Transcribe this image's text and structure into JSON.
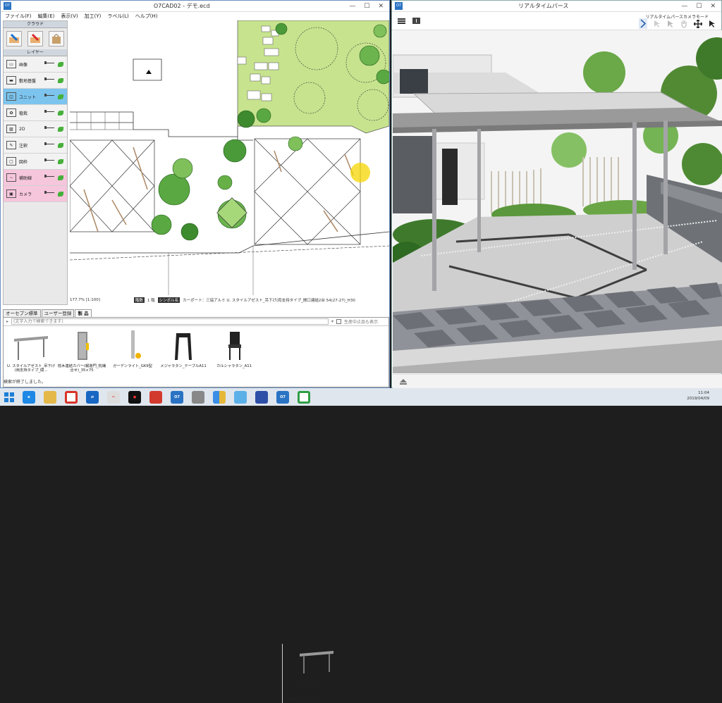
{
  "cad": {
    "title": "O7CAD02 - デモ.ecd",
    "menu": [
      "ファイル(F)",
      "編集(E)",
      "表示(V)",
      "加工(Y)",
      "ラベル(L)",
      "ヘルプ(H)"
    ],
    "cloud_header": "クラウド",
    "layers_header": "レイヤー",
    "layers": [
      {
        "name": "画像",
        "state": "normal",
        "icon": "image-icon"
      },
      {
        "name": "敷地基盤",
        "state": "normal",
        "icon": "site-base-icon"
      },
      {
        "name": "ユニット",
        "state": "selected",
        "icon": "unit-book-icon"
      },
      {
        "name": "植栽",
        "state": "normal",
        "icon": "plant-icon"
      },
      {
        "name": "2D",
        "state": "normal",
        "icon": "hatch-2d-icon"
      },
      {
        "name": "注釈",
        "state": "normal",
        "icon": "annotation-icon"
      },
      {
        "name": "図枠",
        "state": "normal",
        "icon": "frame-icon"
      },
      {
        "name": "補助線",
        "state": "pink",
        "icon": "guide-line-icon"
      },
      {
        "name": "カメラ",
        "state": "pink",
        "icon": "camera-icon"
      }
    ],
    "status": {
      "zoom": "177.7% [1:100]",
      "floor_tag": "階数",
      "floor": "1 階",
      "symbol_tag": "シンボル名",
      "symbol": "カーポート：三協アルミ U. スタイルアゼスト_吊下げ(両支持タイプ_間口連結2台 54(27-27)_H30"
    },
    "tabs": [
      "オーセブン標準",
      "ユーザー登録",
      "製 品"
    ],
    "product_search_placeholder": "(文字入力で検索できます)",
    "discontinued_label": "生産中止品も表示",
    "products": [
      {
        "name": "U. スタイルアゼスト_吊下げ(両支持タイプ_間..."
      },
      {
        "name": "枕木連結カバー(報遊門_枕繊合せ)_35×75"
      },
      {
        "name": "ガーデンライト_GK9型"
      },
      {
        "name": "メジャラタン_テーブルA11"
      },
      {
        "name": "カルシャラタン_A11"
      }
    ],
    "right_item": "54(27-27)_H30",
    "search_done_left": "検索が終了しました。",
    "search_done_right": "検索が終了しました。"
  },
  "perse": {
    "title": "リアルタイムパース",
    "mode_label": "リアルタイムパースカメラモード"
  },
  "taskbar": {
    "time": "11:04",
    "date": "2019/04/09"
  },
  "colors": {
    "selected_layer": "#7cc4ee",
    "pink_layer": "#f6c6dc",
    "lawn": "#c7e38e",
    "accent": "#2a73c4"
  }
}
